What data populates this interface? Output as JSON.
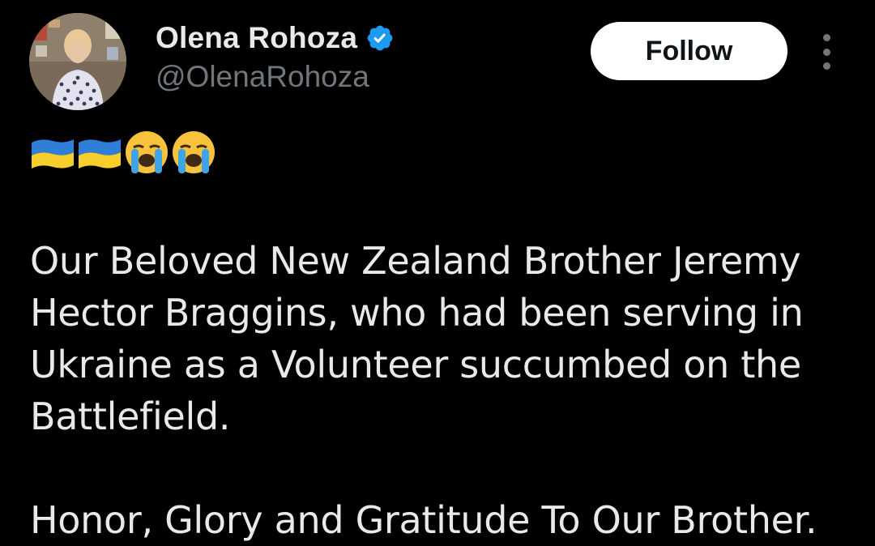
{
  "author": {
    "display_name": "Olena Rohoza",
    "handle": "@OlenaRohoza",
    "verified": true,
    "avatar_icon": "profile-photo"
  },
  "actions": {
    "follow_label": "Follow",
    "more_icon": "more-vertical-icon"
  },
  "tweet": {
    "emojis": [
      "ukraine-flag",
      "ukraine-flag",
      "loudly-crying-face",
      "loudly-crying-face"
    ],
    "lines": [
      "Our Beloved New Zealand Brother Jeremy",
      "Hector Braggins, who had been serving in",
      "Ukraine as a Volunteer succumbed on the",
      "Battlefield."
    ],
    "closing": "Honor, Glory and Gratitude To Our Brother."
  },
  "colors": {
    "background": "#000000",
    "text_primary": "#e7e9ea",
    "text_secondary": "#71767b",
    "verified_blue": "#1d9bf0",
    "follow_bg": "#ffffff"
  }
}
